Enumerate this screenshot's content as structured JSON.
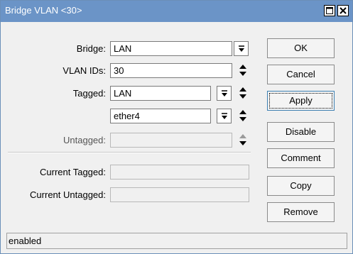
{
  "window": {
    "title": "Bridge VLAN <30>"
  },
  "titlebar_buttons": {
    "maximize_icon": "maximize-icon",
    "close_icon": "close-icon"
  },
  "form": {
    "bridge": {
      "label": "Bridge:",
      "value": "LAN"
    },
    "vlan_ids": {
      "label": "VLAN IDs:",
      "value": "30"
    },
    "tagged": {
      "label": "Tagged:",
      "values": [
        "LAN",
        "ether4"
      ]
    },
    "untagged": {
      "label": "Untagged:",
      "value": ""
    },
    "current_tagged": {
      "label": "Current Tagged:",
      "value": ""
    },
    "current_untagged": {
      "label": "Current Untagged:",
      "value": ""
    }
  },
  "buttons": {
    "ok": "OK",
    "cancel": "Cancel",
    "apply": "Apply",
    "disable": "Disable",
    "comment": "Comment",
    "copy": "Copy",
    "remove": "Remove"
  },
  "status": {
    "text": "enabled"
  },
  "colors": {
    "titlebar": "#6b94c7",
    "window_bg": "#f0f0f0",
    "focus_border": "#3c7fb1"
  }
}
